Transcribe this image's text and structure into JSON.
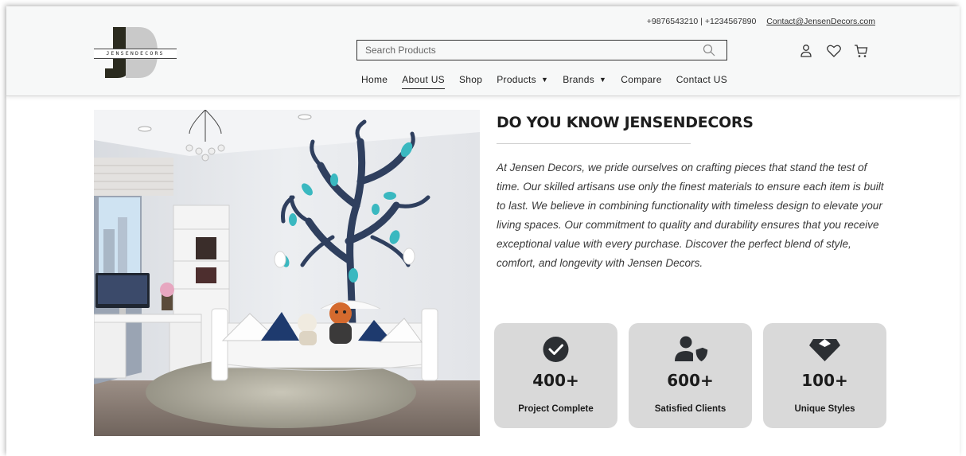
{
  "brand": {
    "logo_text": "JENSENDECORS"
  },
  "header": {
    "phones": "+9876543210 | +1234567890",
    "email": "Contact@JensenDecors.com"
  },
  "search": {
    "placeholder": "Search Products"
  },
  "icons": {
    "search": "search-icon",
    "account": "user-icon",
    "wishlist": "heart-icon",
    "cart": "cart-icon"
  },
  "nav": {
    "items": [
      {
        "label": "Home"
      },
      {
        "label": "About US"
      },
      {
        "label": "Shop"
      },
      {
        "label": "Products"
      },
      {
        "label": "Brands"
      },
      {
        "label": "Compare"
      },
      {
        "label": "Contact US"
      }
    ]
  },
  "about": {
    "title": "DO YOU KNOW JENSENDECORS",
    "body": "At Jensen Decors, we pride ourselves on crafting pieces that stand the test of time. Our skilled artisans use only the finest materials to ensure each item is built to last. We believe in combining functionality with timeless design to elevate your living spaces. Our commitment to quality and durability ensures that you receive exceptional value with every purchase. Discover the perfect blend of style, comfort, and longevity with Jensen Decors."
  },
  "stats": [
    {
      "icon": "check-circle-icon",
      "value": "400+",
      "label": "Project Complete"
    },
    {
      "icon": "user-shield-icon",
      "value": "600+",
      "label": "Satisfied Clients"
    },
    {
      "icon": "gem-icon",
      "value": "100+",
      "label": "Unique Styles"
    }
  ],
  "colors": {
    "header_bg": "#f7f8f8",
    "stat_card_bg": "#d9d9d9",
    "text_dark": "#1e1e1e",
    "accent_teal": "#3ab8c0",
    "tree_navy": "#2f3f5e"
  }
}
